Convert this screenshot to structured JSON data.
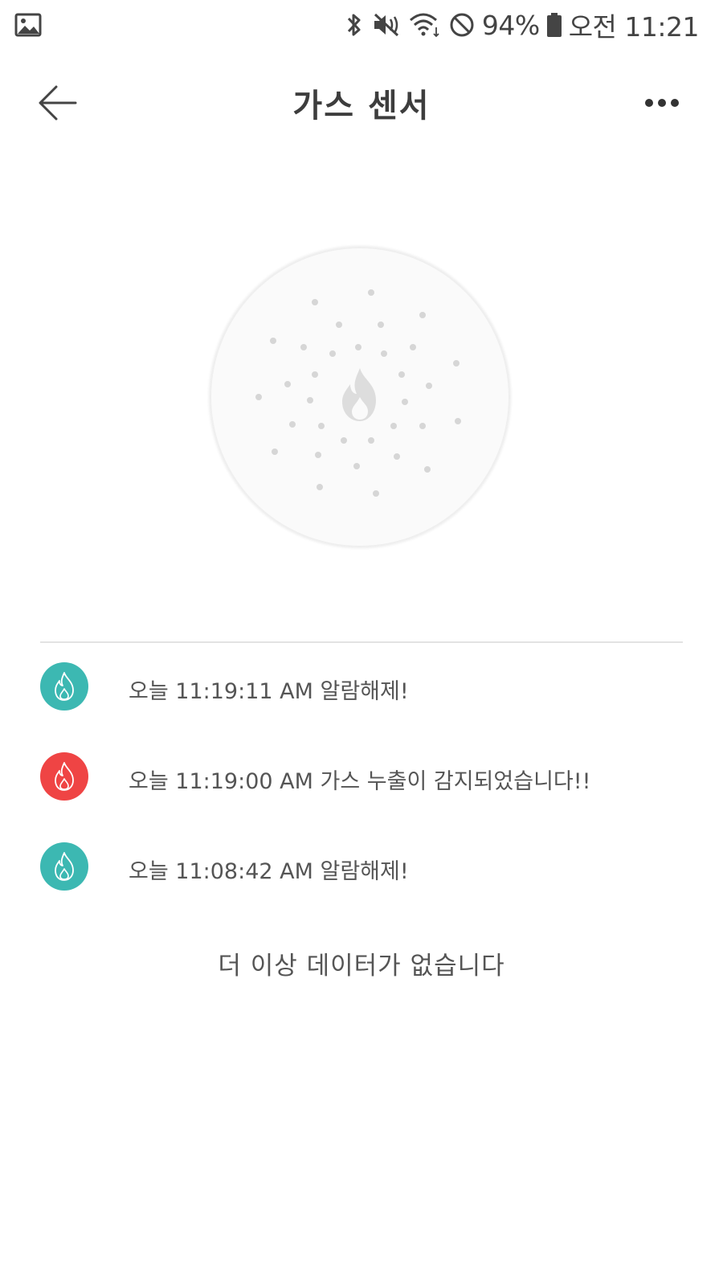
{
  "status_bar": {
    "battery": "94%",
    "time": "오전 11:21",
    "icons": [
      "gallery-icon",
      "bluetooth-icon",
      "mute-icon",
      "wifi-icon",
      "do-not-disturb-icon",
      "battery-icon"
    ]
  },
  "header": {
    "title": "가스 센서",
    "back_icon": "arrow-left-icon",
    "more_icon": "more-dots-icon"
  },
  "sensor": {
    "icon": "flame-icon"
  },
  "logs": [
    {
      "date": "오늘",
      "time": "11:19:11 AM",
      "message": "알람해제!",
      "status": "ok",
      "icon": "flame-icon",
      "color": "#3cb8b2"
    },
    {
      "date": "오늘",
      "time": "11:19:00 AM",
      "message": "가스 누출이 감지되었습니다!!",
      "status": "alarm",
      "icon": "flame-icon",
      "color": "#ef4444"
    },
    {
      "date": "오늘",
      "time": "11:08:42 AM",
      "message": "알람해제!",
      "status": "ok",
      "icon": "flame-icon",
      "color": "#3cb8b2"
    }
  ],
  "end_note": "더 이상 데이터가 없습니다",
  "colors": {
    "ok": "#3cb8b2",
    "alarm": "#ef4444",
    "text": "#555555"
  }
}
